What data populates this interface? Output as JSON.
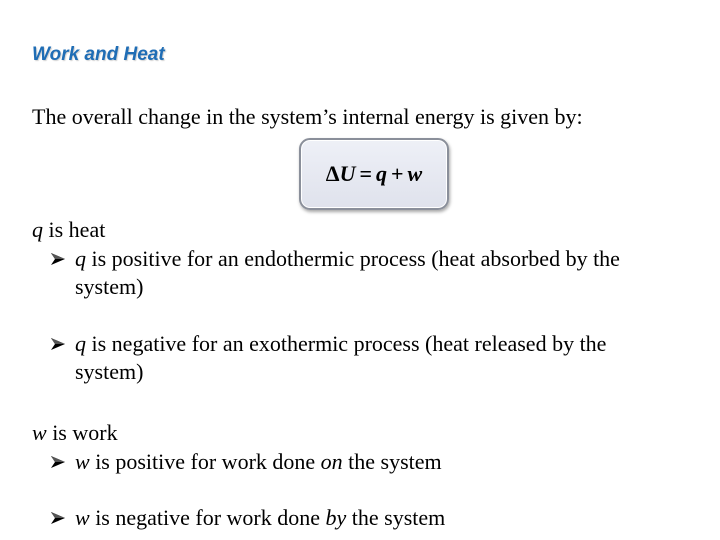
{
  "slide": {
    "title": "Work and Heat",
    "intro": "The overall change in the system’s internal energy is given by:",
    "formula": {
      "lhs_symbol": "Δ",
      "lhs_var": "U",
      "equals": "=",
      "term1": "q",
      "plus": "+",
      "term2": "w"
    },
    "heat": {
      "var": "q",
      "head_text": " is heat",
      "bullets": [
        {
          "var": "q",
          "text": " is positive for an endothermic process (heat absorbed by the system)"
        },
        {
          "var": "q",
          "text": " is negative for an exothermic process (heat released by the system)"
        }
      ]
    },
    "work": {
      "var": "w",
      "head_text": " is work",
      "bullets": [
        {
          "var": "w",
          "text_before": " is positive for work done ",
          "emphasis": "on",
          "text_after": " the system"
        },
        {
          "var": "w",
          "text_before": " is negative for work done ",
          "emphasis": "by",
          "text_after": " the system"
        }
      ]
    }
  }
}
